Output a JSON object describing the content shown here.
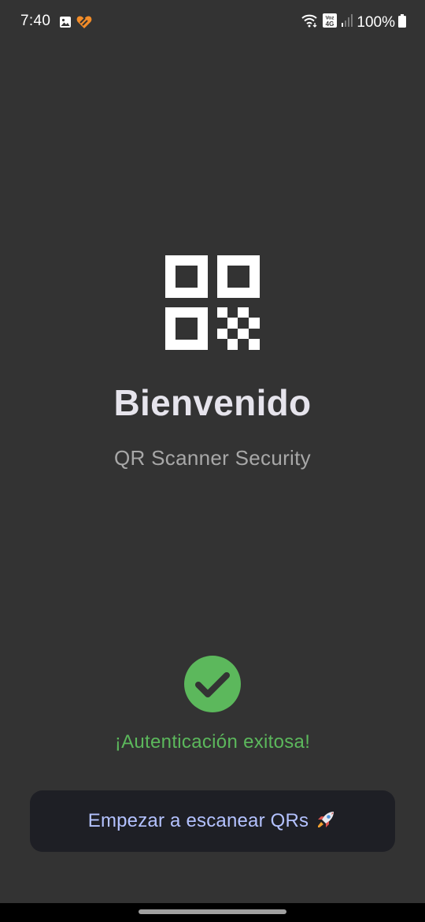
{
  "status_bar": {
    "time": "7:40",
    "left_icons": [
      "gallery-icon",
      "health-app-icon"
    ],
    "right_icons": [
      "wifi-icon",
      "volte-4g-icon",
      "signal-icon",
      "battery-icon"
    ],
    "volte_label": "Voz",
    "network_label": "4G",
    "battery_level": "100%"
  },
  "main": {
    "logo_icon": "qr-code-icon",
    "title": "Bienvenido",
    "subtitle": "QR Scanner Security"
  },
  "auth": {
    "icon": "check-circle-icon",
    "message": "¡Autenticación exitosa!",
    "color": "#5cb85c"
  },
  "action": {
    "button_label": "Empezar a escanear QRs",
    "button_icon": "rocket-icon"
  },
  "colors": {
    "background": "#333333",
    "button_background": "#1e1f25",
    "button_text": "#b4c2ff",
    "title_text": "#e6e4ec"
  }
}
